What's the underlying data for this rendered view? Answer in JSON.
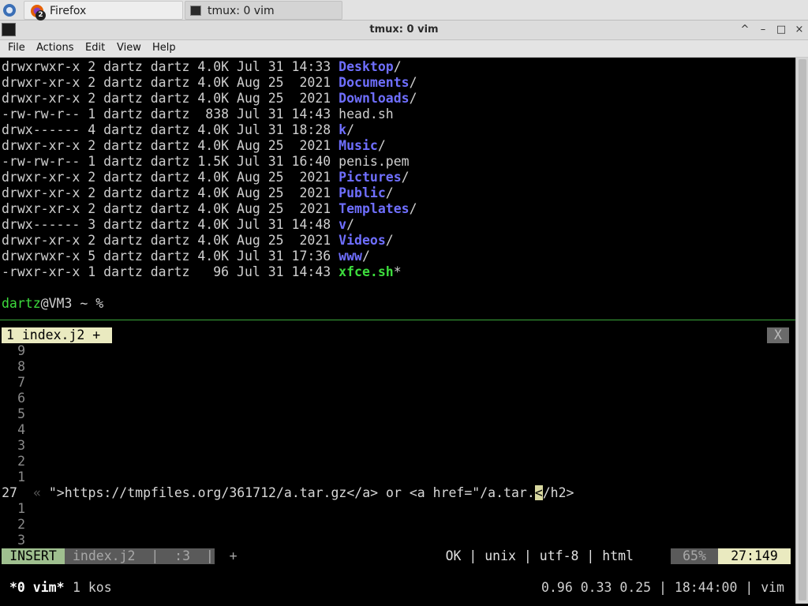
{
  "taskbar": {
    "tasks": [
      {
        "label": "Firefox",
        "badge": "2"
      },
      {
        "label": "tmux: 0 vim"
      }
    ]
  },
  "window": {
    "title": "tmux: 0 vim",
    "buttons": [
      "^",
      "–",
      "□",
      "×"
    ]
  },
  "menubar": {
    "items": [
      "File",
      "Actions",
      "Edit",
      "View",
      "Help"
    ]
  },
  "listing": [
    {
      "perm": "drwxrwxr-x",
      "links": "2",
      "user": "dartz",
      "group": "dartz",
      "size": "4.0K",
      "date": "Jul 31 14:33",
      "name": "Desktop",
      "kind": "dir"
    },
    {
      "perm": "drwxr-xr-x",
      "links": "2",
      "user": "dartz",
      "group": "dartz",
      "size": "4.0K",
      "date": "Aug 25  2021",
      "name": "Documents",
      "kind": "dir"
    },
    {
      "perm": "drwxr-xr-x",
      "links": "2",
      "user": "dartz",
      "group": "dartz",
      "size": "4.0K",
      "date": "Aug 25  2021",
      "name": "Downloads",
      "kind": "dir"
    },
    {
      "perm": "-rw-rw-r--",
      "links": "1",
      "user": "dartz",
      "group": "dartz",
      "size": " 838",
      "date": "Jul 31 14:43",
      "name": "head.sh",
      "kind": "file"
    },
    {
      "perm": "drwx------",
      "links": "4",
      "user": "dartz",
      "group": "dartz",
      "size": "4.0K",
      "date": "Jul 31 18:28",
      "name": "k",
      "kind": "dir"
    },
    {
      "perm": "drwxr-xr-x",
      "links": "2",
      "user": "dartz",
      "group": "dartz",
      "size": "4.0K",
      "date": "Aug 25  2021",
      "name": "Music",
      "kind": "dir"
    },
    {
      "perm": "-rw-rw-r--",
      "links": "1",
      "user": "dartz",
      "group": "dartz",
      "size": "1.5K",
      "date": "Jul 31 16:40",
      "name": "penis.pem",
      "kind": "file"
    },
    {
      "perm": "drwxr-xr-x",
      "links": "2",
      "user": "dartz",
      "group": "dartz",
      "size": "4.0K",
      "date": "Aug 25  2021",
      "name": "Pictures",
      "kind": "dir"
    },
    {
      "perm": "drwxr-xr-x",
      "links": "2",
      "user": "dartz",
      "group": "dartz",
      "size": "4.0K",
      "date": "Aug 25  2021",
      "name": "Public",
      "kind": "dir"
    },
    {
      "perm": "drwxr-xr-x",
      "links": "2",
      "user": "dartz",
      "group": "dartz",
      "size": "4.0K",
      "date": "Aug 25  2021",
      "name": "Templates",
      "kind": "dir"
    },
    {
      "perm": "drwx------",
      "links": "3",
      "user": "dartz",
      "group": "dartz",
      "size": "4.0K",
      "date": "Jul 31 14:48",
      "name": "v",
      "kind": "dir"
    },
    {
      "perm": "drwxr-xr-x",
      "links": "2",
      "user": "dartz",
      "group": "dartz",
      "size": "4.0K",
      "date": "Aug 25  2021",
      "name": "Videos",
      "kind": "dir"
    },
    {
      "perm": "drwxrwxr-x",
      "links": "5",
      "user": "dartz",
      "group": "dartz",
      "size": "4.0K",
      "date": "Jul 31 17:36",
      "name": "www",
      "kind": "dir"
    },
    {
      "perm": "-rwxr-xr-x",
      "links": "1",
      "user": "dartz",
      "group": "dartz",
      "size": "  96",
      "date": "Jul 31 14:43",
      "name": "xfce.sh",
      "kind": "exec"
    }
  ],
  "prompt": {
    "user": "dartz",
    "rest": "@VM3 ~ %"
  },
  "vim": {
    "tab_label": "1 index.j2 +",
    "tab_close": "X",
    "line_numbers_above": [
      "9",
      "8",
      "7",
      "6",
      "5",
      "4",
      "3",
      "2",
      "1"
    ],
    "current_line_number": "27",
    "line_numbers_below": [
      "1",
      "2",
      "3"
    ],
    "code_marker": "«",
    "code_before_cursor": "\">https://tmpfiles.org/361712/a.tar.gz</a> or <a href=\"/a.tar.",
    "cursor_char": "<",
    "code_after_cursor": "/h2>",
    "status": {
      "mode": "INSERT",
      "file": "index.j2  |  :3  |  +",
      "right": "OK | unix | utf-8 | html",
      "percent": "65%",
      "position": "27:149"
    }
  },
  "tmux": {
    "window_active": "*0 vim*",
    "window_other": "1 kos",
    "right": "0.96 0.33 0.25 | 18:44:00 | vim"
  },
  "colors": {
    "directory": "#6f6fff",
    "executable": "#3ddd3d",
    "prompt_user": "#3ddd3d",
    "insert_mode": "#9fbf8f"
  }
}
